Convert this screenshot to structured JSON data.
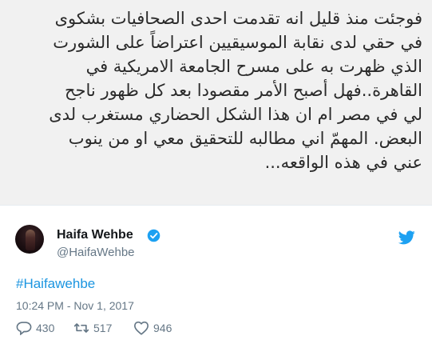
{
  "tweet_image": {
    "text": "فوجئت منذ قليل انه تقدمت احدى الصحافيات بشكوى\nفي حقي لدى نقابة الموسيقيين اعتراضاً على الشورت\nالذي ظهرت به على مسرح الجامعة الامريكية في\nالقاهرة..فهل أصبح الأمر مقصودا بعد كل ظهور ناجح\nلي في مصر ام ان هذا الشكل الحضاري مستغرب لدى\nالبعض. المهمّ اني مطالبه للتحقيق معي او من ينوب\nعني في هذه الواقعه..."
  },
  "author": {
    "display_name": "Haifa Wehbe",
    "handle": "@HaifaWehbe",
    "verified": true
  },
  "tweet": {
    "hashtag": "#Haifawehbe",
    "timestamp": "10:24 PM - Nov 1, 2017"
  },
  "actions": {
    "replies": "430",
    "retweets": "517",
    "likes": "946"
  },
  "colors": {
    "link": "#1b95e0",
    "muted": "#657786",
    "verified": "#1da1f2",
    "image_bg": "#f1f1f1"
  }
}
